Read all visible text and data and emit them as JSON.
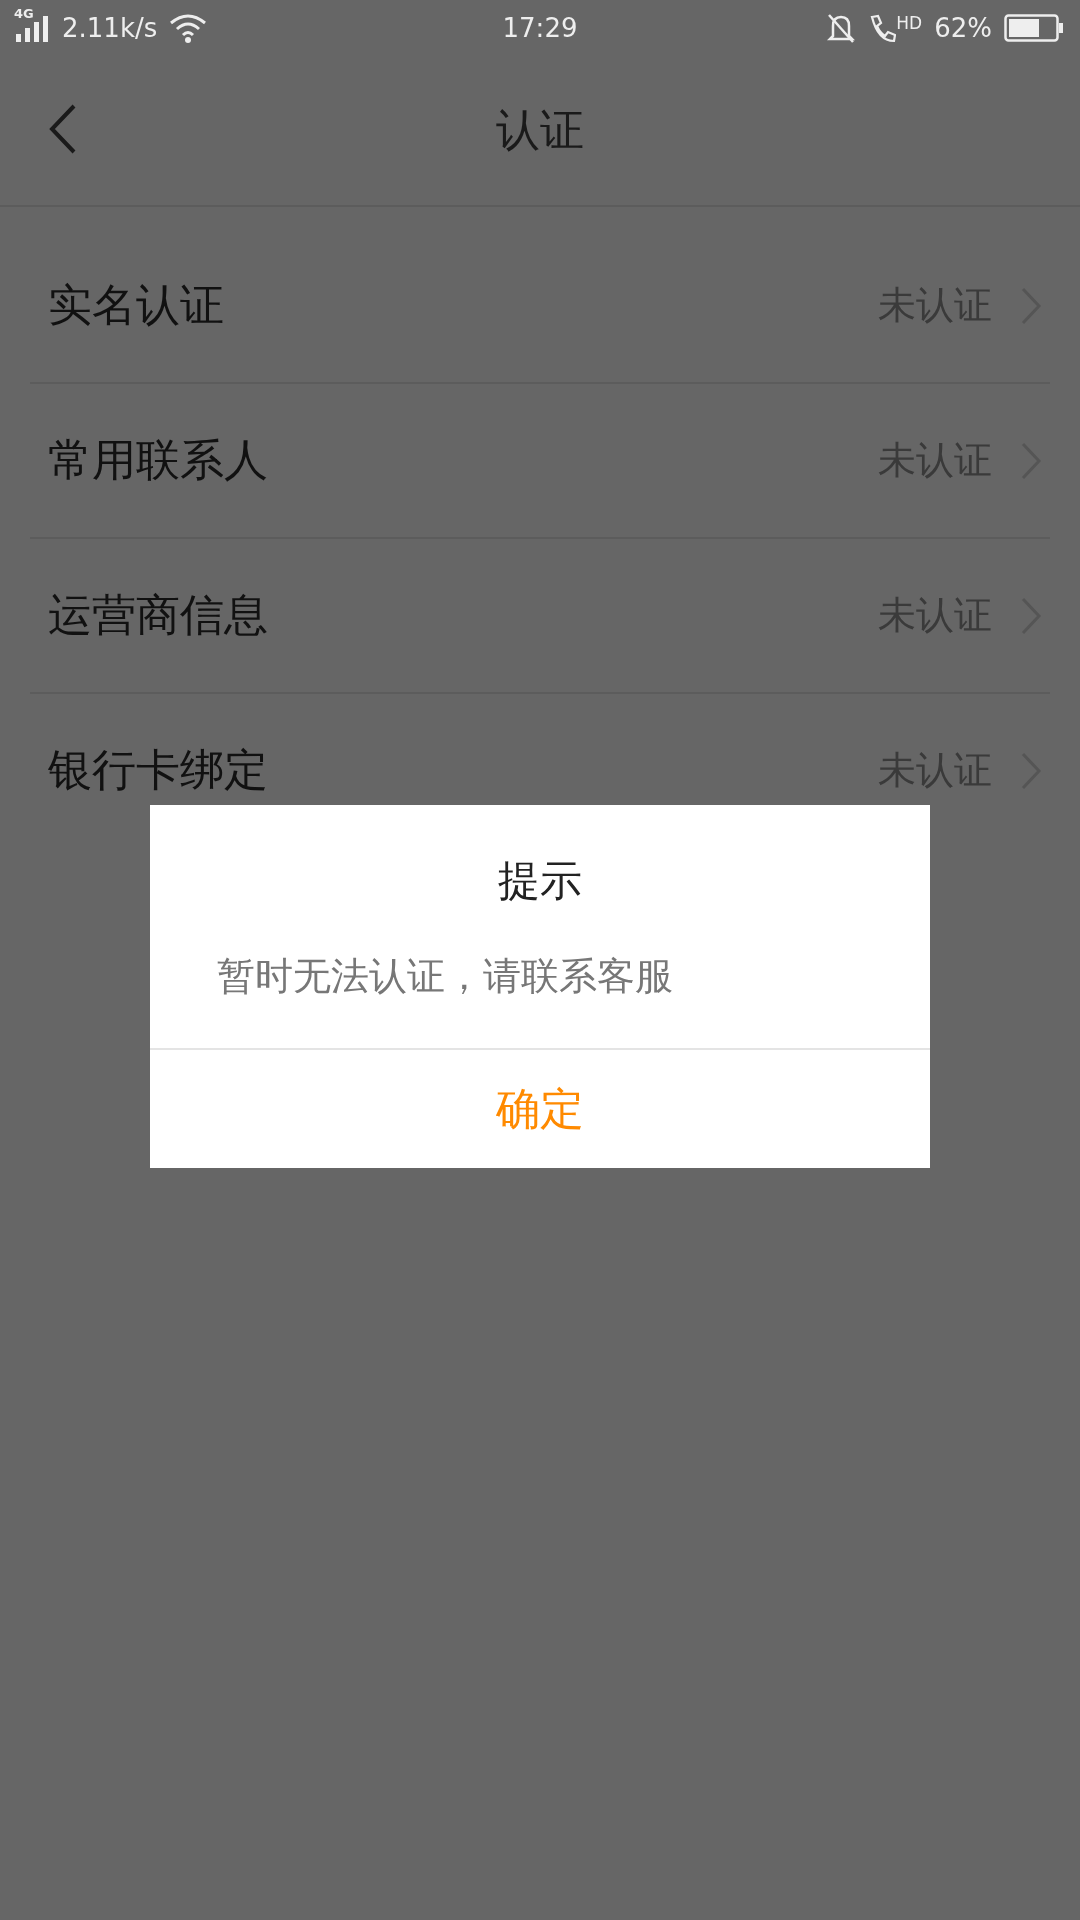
{
  "status_bar": {
    "network": "4G",
    "speed": "2.11k/s",
    "time": "17:29",
    "call_badge": "HD",
    "battery": "62%"
  },
  "header": {
    "title": "认证"
  },
  "items": [
    {
      "label": "实名认证",
      "status": "未认证"
    },
    {
      "label": "常用联系人",
      "status": "未认证"
    },
    {
      "label": "运营商信息",
      "status": "未认证"
    },
    {
      "label": "银行卡绑定",
      "status": "未认证"
    }
  ],
  "dialog": {
    "title": "提示",
    "message": "暂时无法认证，请联系客服",
    "button": "确定"
  }
}
